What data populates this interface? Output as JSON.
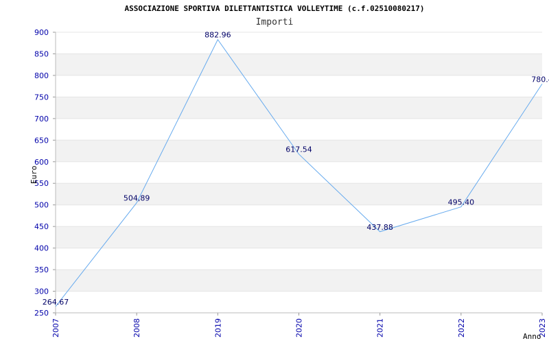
{
  "chart_data": {
    "type": "line",
    "title": "ASSOCIAZIONE SPORTIVA DILETTANTISTICA VOLLEYTIME (c.f.02510080217)",
    "subtitle": "Importi",
    "xlabel": "Anno",
    "ylabel": "Euro",
    "categories": [
      "2007",
      "2008",
      "2019",
      "2020",
      "2021",
      "2022",
      "2023"
    ],
    "series": [
      {
        "values": [
          264.67,
          504.89,
          882.96,
          617.54,
          437.88,
          495.4,
          780.4
        ],
        "labels": [
          "264.67",
          "504,89",
          "882.96",
          "617.54",
          "437.88",
          "495.40",
          "780.4"
        ]
      }
    ],
    "ylim": [
      250,
      900
    ],
    "yticks": [
      250,
      300,
      350,
      400,
      450,
      500,
      550,
      600,
      650,
      700,
      750,
      800,
      850,
      900
    ],
    "grid": true,
    "colors": {
      "line": "#66aaee",
      "band": "#f2f2f2",
      "tick_text": "#0000aa",
      "label_text": "#000066"
    }
  }
}
